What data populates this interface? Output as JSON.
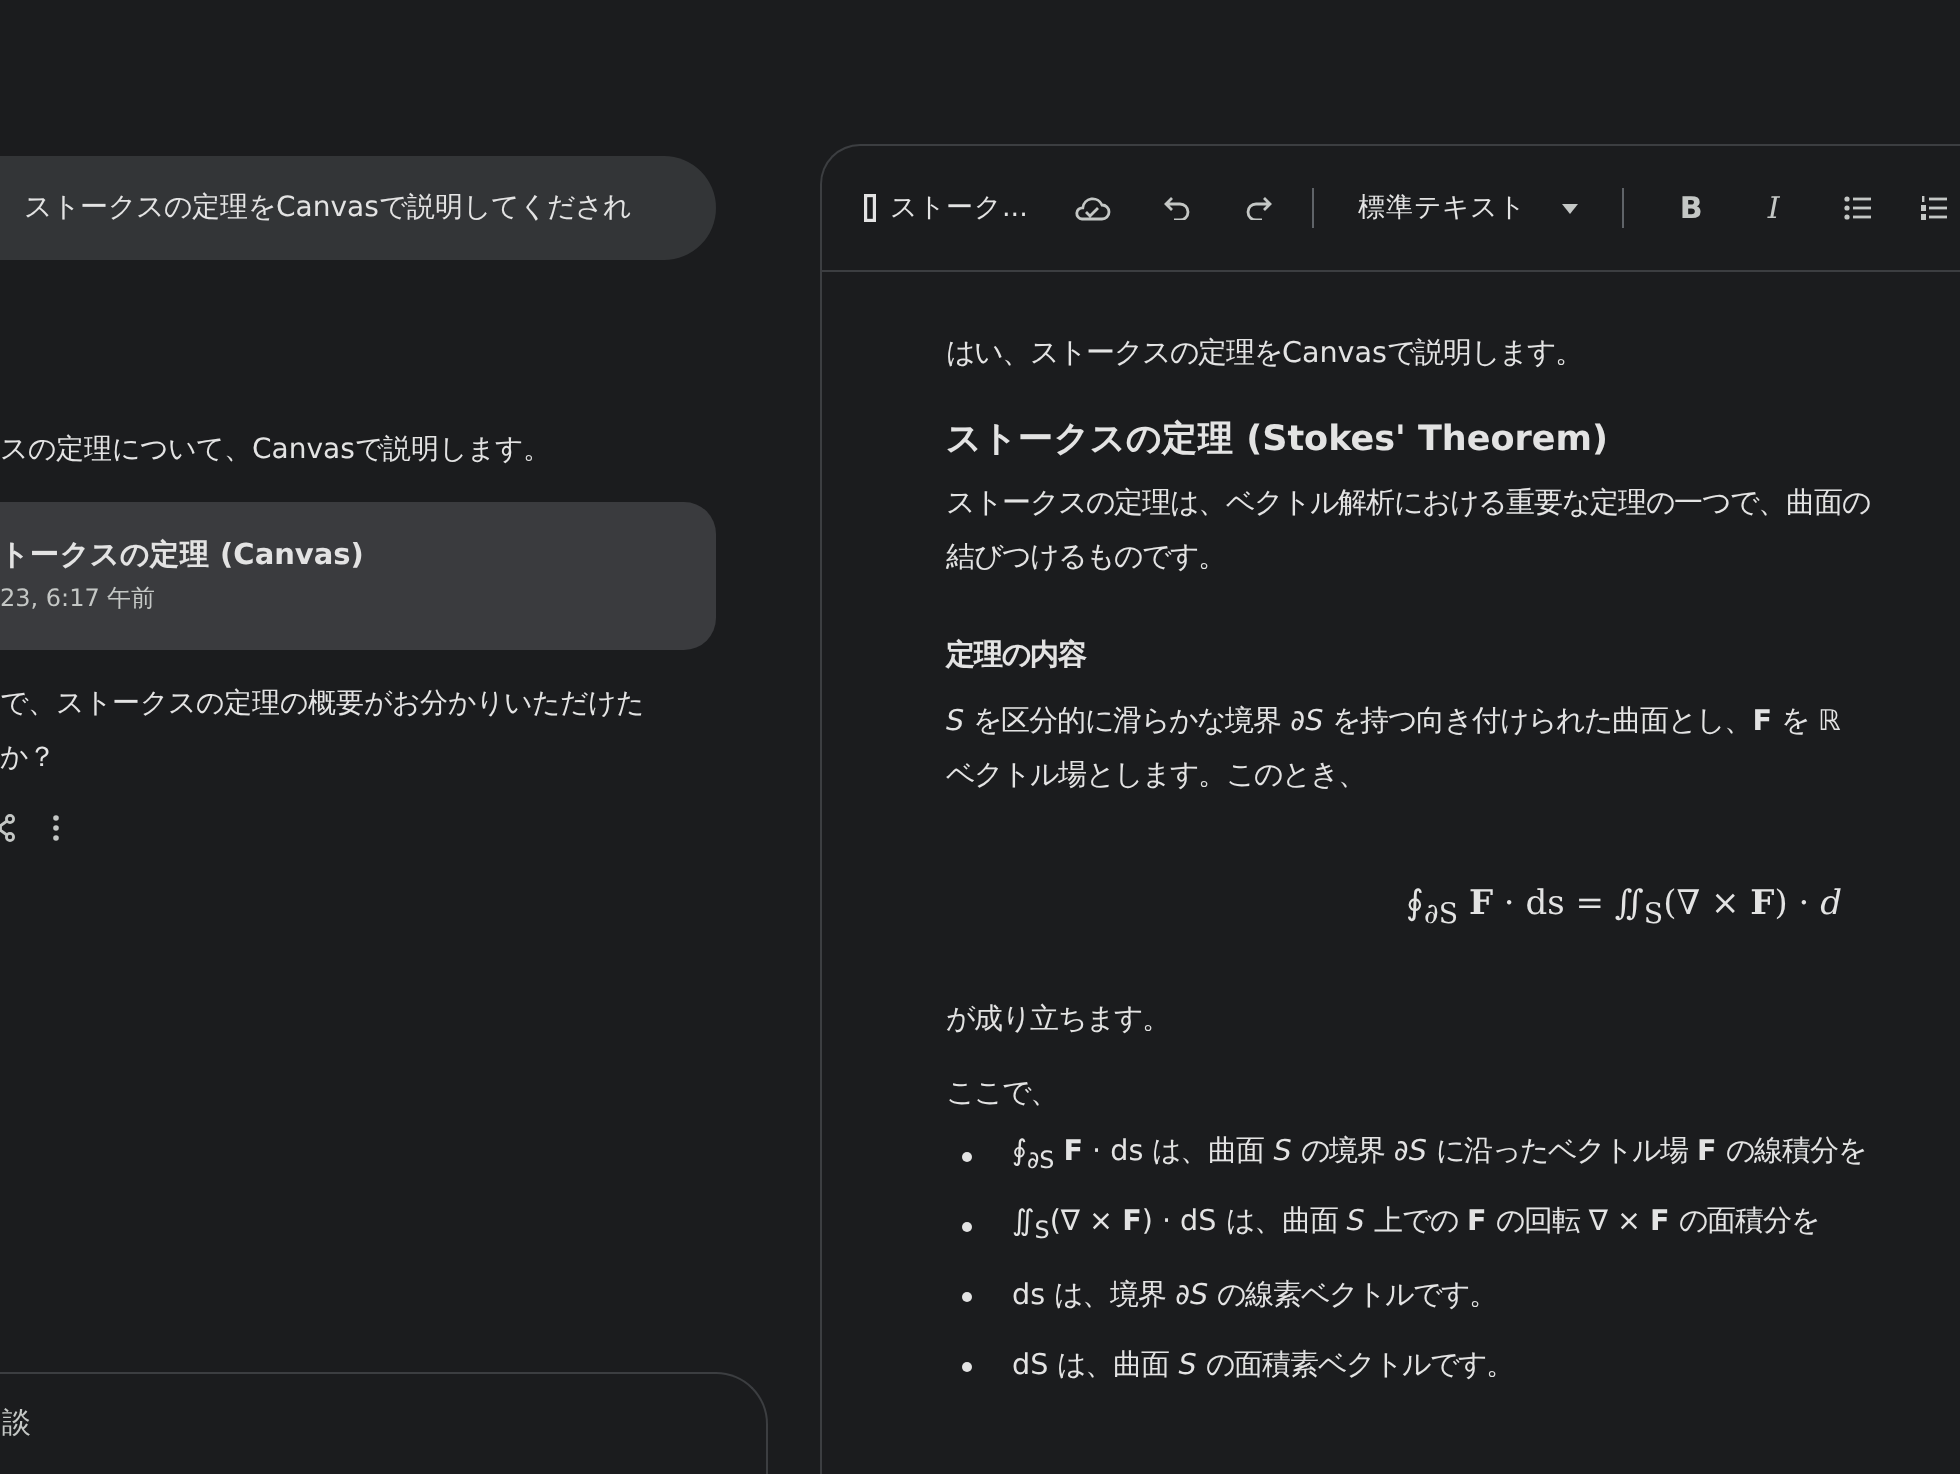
{
  "chat": {
    "user_message": "ストークスの定理をCanvasで説明してくだされ",
    "reply_intro": "スの定理について、Canvasで説明します。",
    "canvas_card": {
      "title": "トークスの定理 (Canvas)",
      "date": "23, 6:17 午前"
    },
    "reply_outro_lines": [
      "で、ストークスの定理の概要がお分かりいただけた",
      "か？"
    ],
    "input": {
      "placeholder": "談"
    }
  },
  "canvas": {
    "toolbar": {
      "doc_title": "ストーク...",
      "style_dropdown": "標準テキスト",
      "format_buttons": [
        {
          "kind": "bold",
          "label": "B"
        },
        {
          "kind": "italic",
          "label": "I"
        },
        {
          "kind": "bullets"
        },
        {
          "kind": "numbered"
        }
      ]
    },
    "blocks": [
      {
        "kind": "p",
        "text": "はい、ストークスの定理をCanvasで説明します。"
      },
      {
        "kind": "h2",
        "text": "ストークスの定理 (Stokes' Theorem)"
      },
      {
        "kind": "p",
        "text": "ストークスの定理は、ベクトル解析における重要な定理の一つで、曲面の"
      },
      {
        "kind": "p2",
        "text": "結びつけるものです。"
      },
      {
        "kind": "h3",
        "text": "定理の内容"
      },
      {
        "kind": "p",
        "text": "*S* を区分的に滑らかな境界 *∂S* を持つ向き付けられた曲面とし、**F** を ℝ"
      },
      {
        "kind": "p2",
        "text": "ベクトル場とします。このとき、"
      },
      {
        "kind": "eq",
        "text": "∮$_{∂S}$ **F** · ds = ∬$_{S}$(∇ × **F**) · *d*"
      },
      {
        "kind": "p",
        "text": "が成り立ちます。"
      },
      {
        "kind": "p",
        "text": "ここで、"
      },
      {
        "kind": "li",
        "text": "∮$_{∂S}$ **F** · ds は、曲面 *S* の境界 *∂S* に沿ったベクトル場 **F** の線積分を"
      },
      {
        "kind": "li",
        "text": "∬$_{S}$(∇ × **F**) · dS は、曲面 *S* 上での **F** の回転 ∇ × **F** の面積分を"
      },
      {
        "kind": "li",
        "text": "ds は、境界 *∂S* の線素ベクトルです。"
      },
      {
        "kind": "li",
        "text": "dS は、曲面 *S* の面積素ベクトルです。"
      }
    ]
  }
}
